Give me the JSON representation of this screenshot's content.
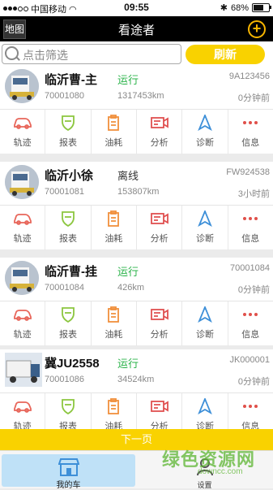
{
  "status_bar": {
    "carrier": "中国移动",
    "time": "09:55",
    "battery": "68%",
    "battery_level": 0.68
  },
  "nav": {
    "map_label": "地图",
    "title": "看途者",
    "add_icon": "plus-circle-icon"
  },
  "search": {
    "placeholder": "点击筛选",
    "refresh_label": "刷新"
  },
  "colors": {
    "accent": "#f9d200",
    "running": "#2bb34a",
    "offline": "#333333"
  },
  "actions": [
    {
      "label": "轨迹",
      "icon": "car-icon",
      "color": "#e8665a"
    },
    {
      "label": "报表",
      "icon": "shield-icon",
      "color": "#8cc63f"
    },
    {
      "label": "油耗",
      "icon": "clipboard-icon",
      "color": "#f0903c"
    },
    {
      "label": "分析",
      "icon": "projector-icon",
      "color": "#e05050"
    },
    {
      "label": "诊断",
      "icon": "navigation-arrow-icon",
      "color": "#3d8fd8"
    },
    {
      "label": "信息",
      "icon": "more-dots-icon",
      "color": "#e0504a"
    }
  ],
  "vehicles": [
    {
      "name": "临沂曹-主",
      "status": "运行",
      "id": "9A123456",
      "number": "70001080",
      "km": "1317453km",
      "time": "0分钟前"
    },
    {
      "name": "临沂小徐",
      "status": "离线",
      "id": "FW924538",
      "number": "70001081",
      "km": "153807km",
      "time": "3小时前"
    },
    {
      "name": "临沂曹-挂",
      "status": "运行",
      "id": "70001084",
      "number": "70001084",
      "km": "426km",
      "time": "0分钟前"
    },
    {
      "name": "冀JU2558",
      "status": "运行",
      "id": "JK000001",
      "number": "70001086",
      "km": "34524km",
      "time": "0分钟前"
    }
  ],
  "next_page_label": "下一页",
  "tabs": {
    "mycar_label": "我的车",
    "settings_label": "设置"
  },
  "watermark": {
    "text": "绿色资源网",
    "url": "downcc.com"
  }
}
